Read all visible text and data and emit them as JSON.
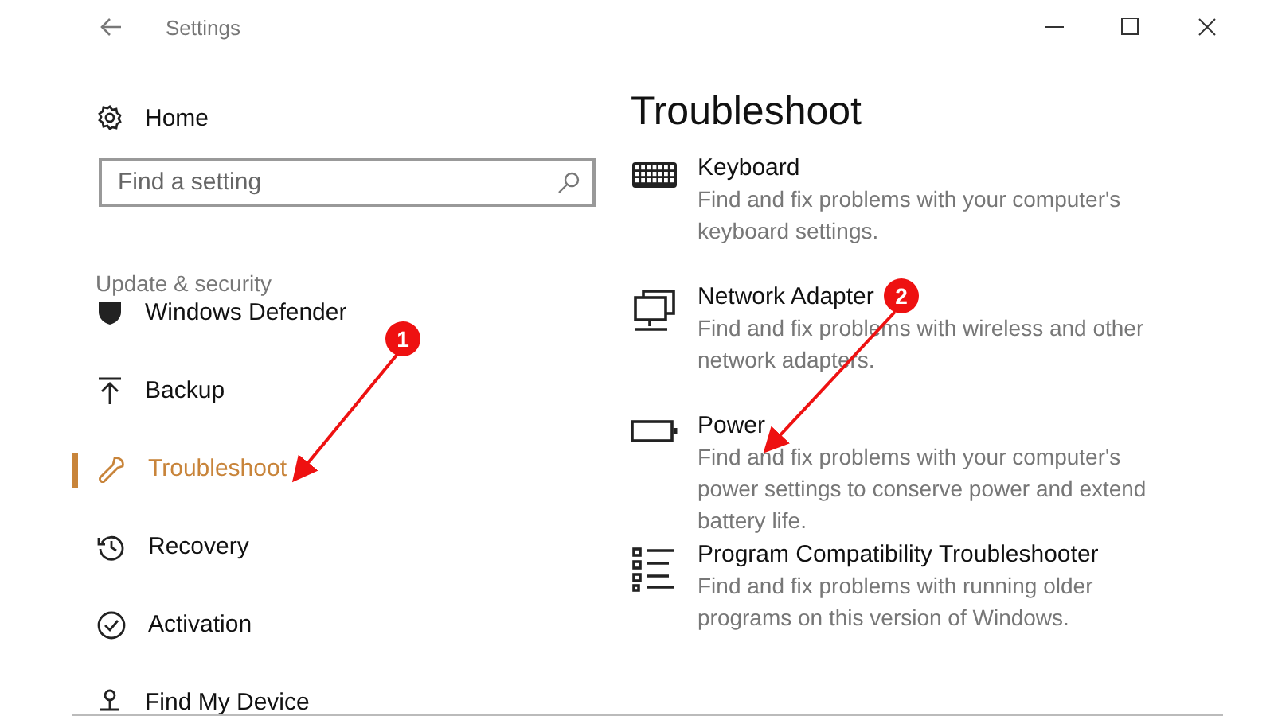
{
  "window": {
    "title": "Settings"
  },
  "sidebar": {
    "home": "Home",
    "search": {
      "placeholder": "Find a setting"
    },
    "section": "Update & security",
    "items": [
      {
        "label": "Windows Defender",
        "selected": false
      },
      {
        "label": "Backup",
        "selected": false
      },
      {
        "label": "Troubleshoot",
        "selected": true
      },
      {
        "label": "Recovery",
        "selected": false
      },
      {
        "label": "Activation",
        "selected": false
      },
      {
        "label": "Find My Device",
        "selected": false
      }
    ]
  },
  "content": {
    "title": "Troubleshoot",
    "items": [
      {
        "title": "Keyboard",
        "description": "Find and fix problems with your computer's keyboard settings."
      },
      {
        "title": "Network Adapter",
        "description": "Find and fix problems with wireless and other network adapters."
      },
      {
        "title": "Power",
        "description": "Find and fix problems with your computer's power settings to conserve power and extend battery life."
      },
      {
        "title": "Program Compatibility Troubleshooter",
        "description": "Find and fix problems with running older programs on this version of Windows."
      }
    ]
  },
  "annotations": [
    {
      "number": "1"
    },
    {
      "number": "2"
    }
  ]
}
